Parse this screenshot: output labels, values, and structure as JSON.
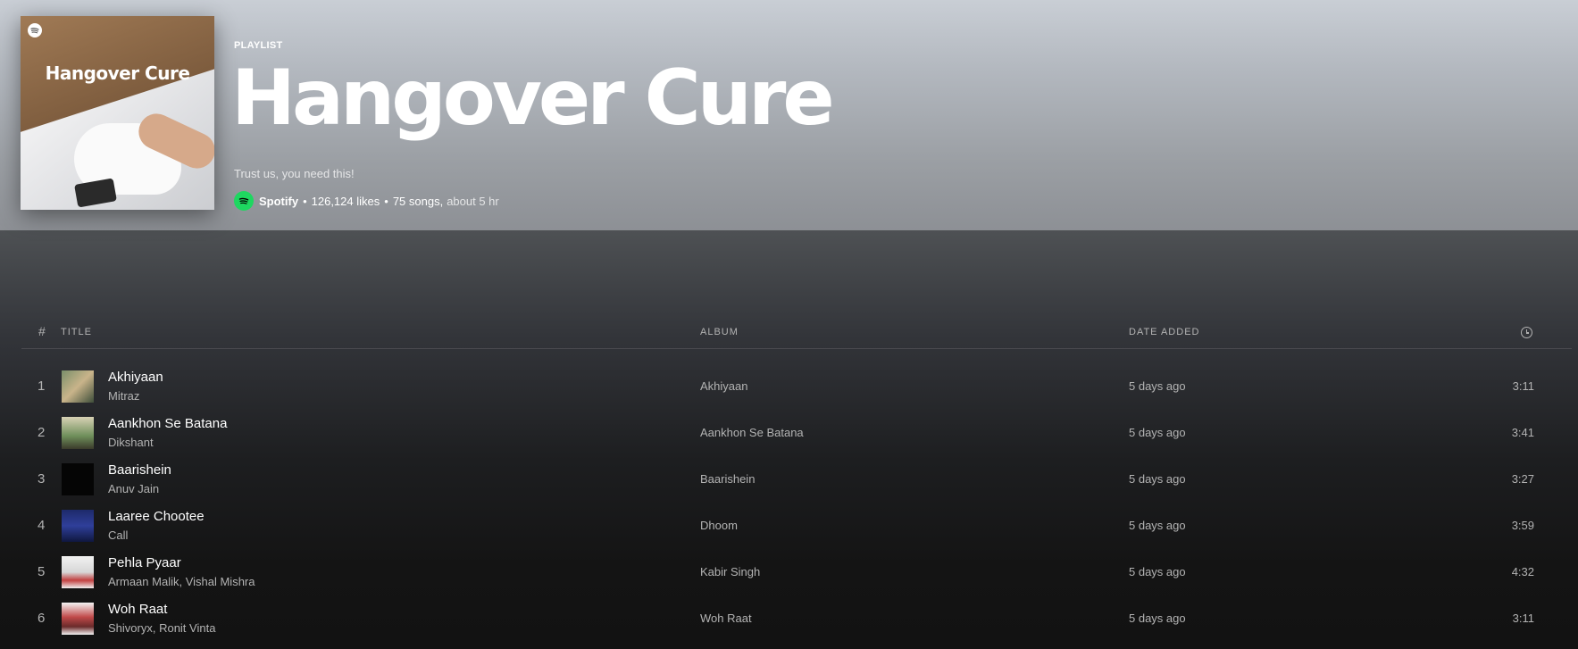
{
  "playlist": {
    "type_label": "PLAYLIST",
    "cover_title": "Hangover Cure",
    "title": "Hangover Cure",
    "description": "Trust us, you need this!",
    "owner": "Spotify",
    "likes": "126,124 likes",
    "songs": "75 songs,",
    "duration": "about 5 hr",
    "separator": "•"
  },
  "table": {
    "headers": {
      "num": "#",
      "title": "TITLE",
      "album": "ALBUM",
      "date_added": "DATE ADDED"
    },
    "rows": [
      {
        "num": "1",
        "title": "Akhiyaan",
        "artist": "Mitraz",
        "album": "Akhiyaan",
        "date": "5 days ago",
        "duration": "3:11"
      },
      {
        "num": "2",
        "title": "Aankhon Se Batana",
        "artist": "Dikshant",
        "album": "Aankhon Se Batana",
        "date": "5 days ago",
        "duration": "3:41"
      },
      {
        "num": "3",
        "title": "Baarishein",
        "artist": "Anuv Jain",
        "album": "Baarishein",
        "date": "5 days ago",
        "duration": "3:27"
      },
      {
        "num": "4",
        "title": "Laaree Chootee",
        "artist": "Call",
        "album": "Dhoom",
        "date": "5 days ago",
        "duration": "3:59"
      },
      {
        "num": "5",
        "title": "Pehla Pyaar",
        "artist": "Armaan Malik, Vishal Mishra",
        "album": "Kabir Singh",
        "date": "5 days ago",
        "duration": "4:32"
      },
      {
        "num": "6",
        "title": "Woh Raat",
        "artist": "Shivoryx, Ronit Vinta",
        "album": "Woh Raat",
        "date": "5 days ago",
        "duration": "3:11"
      }
    ]
  },
  "icons": {
    "clock": "clock-icon",
    "spotify": "spotify-logo-icon"
  },
  "colors": {
    "spotify_green": "#1ed760",
    "background": "#121212",
    "text_muted": "#b3b3b3"
  }
}
